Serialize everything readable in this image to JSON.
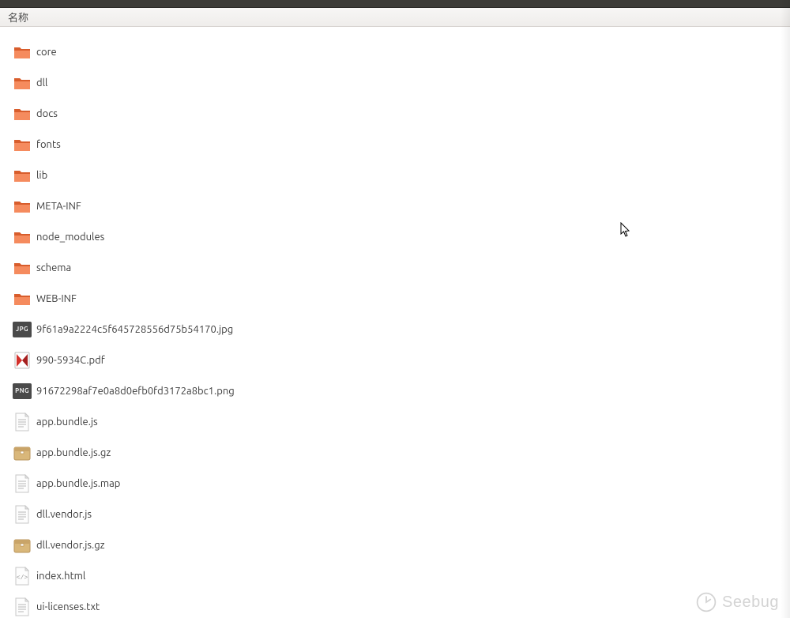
{
  "header": {
    "name_column": "名称"
  },
  "items": [
    {
      "kind": "folder",
      "name": "core"
    },
    {
      "kind": "folder",
      "name": "dll"
    },
    {
      "kind": "folder",
      "name": "docs"
    },
    {
      "kind": "folder",
      "name": "fonts"
    },
    {
      "kind": "folder",
      "name": "lib"
    },
    {
      "kind": "folder",
      "name": "META-INF"
    },
    {
      "kind": "folder",
      "name": "node_modules"
    },
    {
      "kind": "folder",
      "name": "schema"
    },
    {
      "kind": "folder",
      "name": "WEB-INF"
    },
    {
      "kind": "jpg",
      "name": "9f61a9a2224c5f645728556d75b54170.jpg"
    },
    {
      "kind": "pdf",
      "name": "990-5934C.pdf"
    },
    {
      "kind": "png",
      "name": "91672298af7e0a8d0efb0fd3172a8bc1.png"
    },
    {
      "kind": "txt",
      "name": "app.bundle.js"
    },
    {
      "kind": "archive",
      "name": "app.bundle.js.gz"
    },
    {
      "kind": "txt",
      "name": "app.bundle.js.map"
    },
    {
      "kind": "txt",
      "name": "dll.vendor.js"
    },
    {
      "kind": "archive",
      "name": "dll.vendor.js.gz"
    },
    {
      "kind": "html",
      "name": "index.html"
    },
    {
      "kind": "txt",
      "name": "ui-licenses.txt"
    }
  ],
  "badges": {
    "jpg": "JPG",
    "png": "PNG"
  },
  "watermark": "Seebug"
}
